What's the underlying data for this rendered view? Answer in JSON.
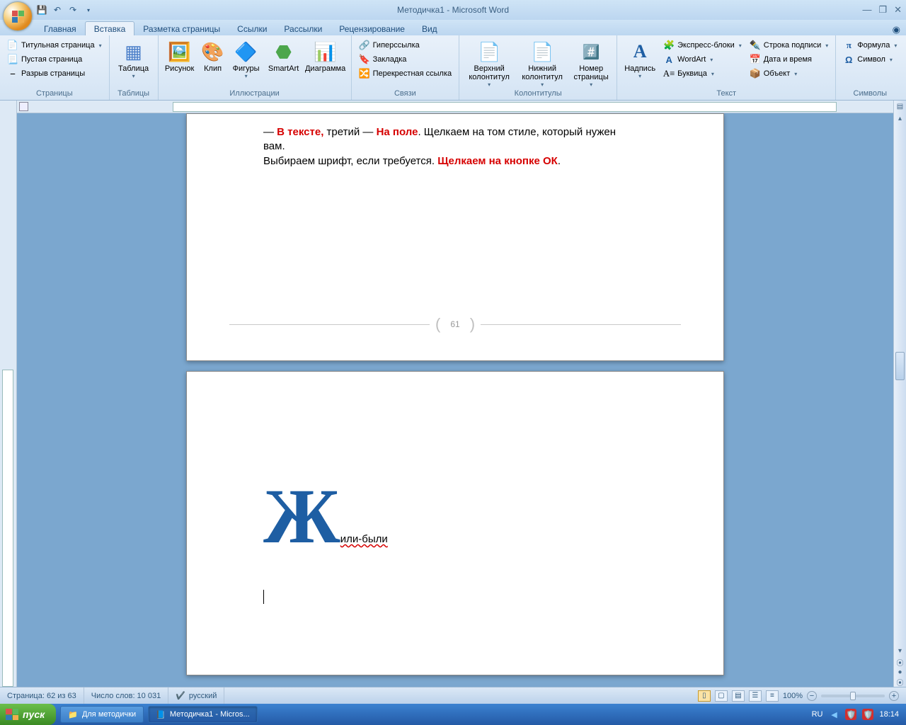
{
  "title": "Методичка1 - Microsoft Word",
  "tabs": {
    "home": "Главная",
    "insert": "Вставка",
    "layout": "Разметка страницы",
    "refs": "Ссылки",
    "mail": "Рассылки",
    "review": "Рецензирование",
    "view": "Вид"
  },
  "ribbon": {
    "pages": {
      "label": "Страницы",
      "cover": "Титульная страница",
      "blank": "Пустая страница",
      "break": "Разрыв страницы"
    },
    "tables": {
      "label": "Таблицы",
      "table": "Таблица"
    },
    "illus": {
      "label": "Иллюстрации",
      "picture": "Рисунок",
      "clip": "Клип",
      "shapes": "Фигуры",
      "smartart": "SmartArt",
      "chart": "Диаграмма"
    },
    "links": {
      "label": "Связи",
      "hyperlink": "Гиперссылка",
      "bookmark": "Закладка",
      "crossref": "Перекрестная ссылка"
    },
    "hf": {
      "label": "Колонтитулы",
      "header": "Верхний колонтитул",
      "footer": "Нижний колонтитул",
      "pagenum": "Номер страницы"
    },
    "text": {
      "label": "Текст",
      "textbox": "Надпись",
      "quick": "Экспресс-блоки",
      "wordart": "WordArt",
      "dropcap": "Буквица",
      "sigline": "Строка подписи",
      "datetime": "Дата и время",
      "object": "Объект"
    },
    "symbols": {
      "label": "Символы",
      "equation": "Формула",
      "symbol": "Символ"
    }
  },
  "document": {
    "line1_a": "— ",
    "line1_b": "В тексте,",
    "line1_c": "  третий — ",
    "line1_d": "На поле",
    "line1_e": ". Щелкаем на том стиле, который нужен вам.",
    "line2_a": "Выбираем шрифт, если требуется. ",
    "line2_b": "Щелкаем на кнопке ОК",
    "line2_c": ".",
    "pagenum": "61",
    "dropcap": "Ж",
    "dropcap_rest": "или-были"
  },
  "status": {
    "page": "Страница: 62 из 63",
    "words": "Число слов: 10 031",
    "lang": "русский",
    "zoom": "100%"
  },
  "taskbar": {
    "start": "пуск",
    "item1": "Для методички",
    "item2": "Методичка1 - Micros...",
    "lang": "RU",
    "time": "18:14"
  }
}
